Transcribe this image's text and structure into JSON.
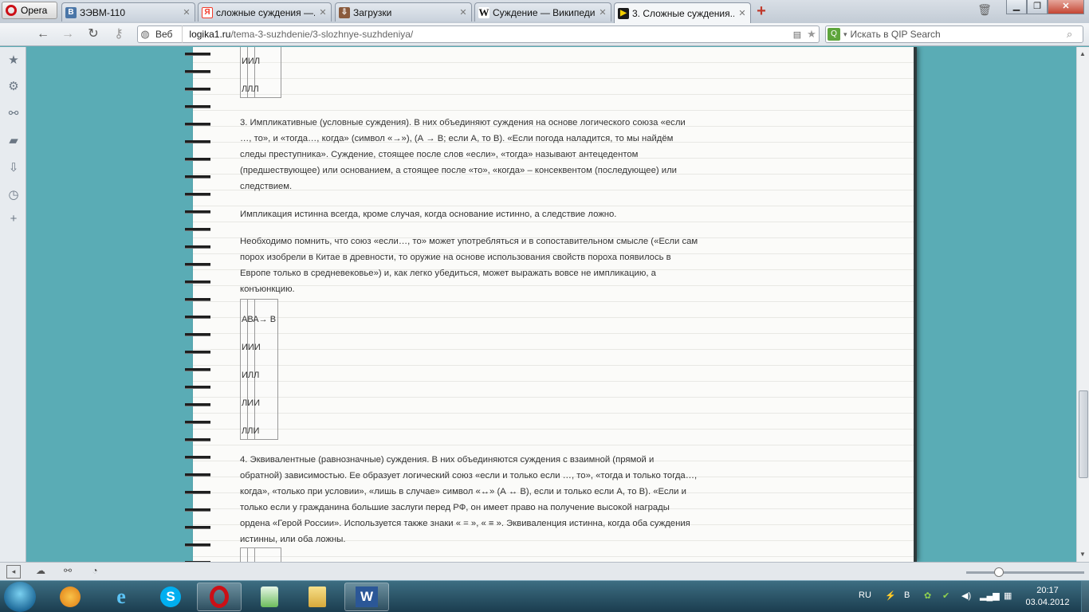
{
  "browser": {
    "opera_label": "Opera",
    "tabs": [
      {
        "label": "ЗЭВМ-110",
        "icon": "vk-icon",
        "color": "#4a76a8",
        "glyph": "В"
      },
      {
        "label": "сложные суждения —...",
        "icon": "yandex-icon",
        "color": "#f23b2b",
        "glyph": "Я"
      },
      {
        "label": "Загрузки",
        "icon": "downloads-icon",
        "color": "#8a5a3c",
        "glyph": "⇩"
      },
      {
        "label": "Суждение — Википедия",
        "icon": "wikipedia-icon",
        "color": "#ffffff",
        "glyph": "W"
      },
      {
        "label": "3. Сложные суждения...",
        "icon": "site-icon",
        "color": "#1a1a1a",
        "glyph": "▶"
      }
    ],
    "active_tab": 4,
    "address": {
      "mode_label": "Веб",
      "domain": "logika1.ru",
      "path": "/tema-3-suzhdenie/3-slozhnye-suzhdeniya/"
    },
    "search": {
      "placeholder": "Искать в QIP Search"
    }
  },
  "page": {
    "table_top": {
      "rows": [
        "ИИЛ",
        "ЛЛЛ"
      ]
    },
    "para_implication": "3. Импликативные (условные суждения). В них объединяют суждения на основе логического союза «если …, то», и «тогда…, когда» (символ «→»), (А → В; если А, то В). «Если погода наладится, то мы найдём следы преступника». Суждение, стоящее после слов «если», «тогда» называют антецедентом (предшествующее) или основанием, а стоящее после «то», «когда» – консеквентом (последующее) или следствием.",
    "para_truth": "Импликация истинна всегда, кроме случая, когда основание истинно, а следствие ложно.",
    "para_remember": "Необходимо помнить, что союз «если…, то» может употребляться и в сопоставительном смысле («Если сам порох изобрели в Китае в древности, то оружие на основе использования свойств пороха появилось в Европе только в средневековье») и, как легко убедиться, может выражать вовсе не импликацию, а конъюнкцию.",
    "table_impl": {
      "header": "АВА→ В",
      "rows": [
        "ИИИ",
        "ИЛЛ",
        "ЛИИ",
        "ЛЛИ"
      ]
    },
    "para_equivalence": "4. Эквивалентные (равнозначные) суждения. В них объединяются суждения с взаимной (прямой и обратной) зависимостью. Ее образует логический союз «если и только если …, то», «тогда и только тогда…, когда», «только при условии», «лишь в случае» символ «↔» (А ↔ В), если и только если А, то В). «Если и только если у гражданина большие заслуги перед РФ, он имеет право на получение высокой награды ордена «Герой России». Используется также знаки « = », « ≡ ». Эквиваленция истинна, когда оба суждения истинны, или оба ложны."
  },
  "taskbar": {
    "lang": "RU",
    "time": "20:17",
    "date": "03.04.2012"
  }
}
